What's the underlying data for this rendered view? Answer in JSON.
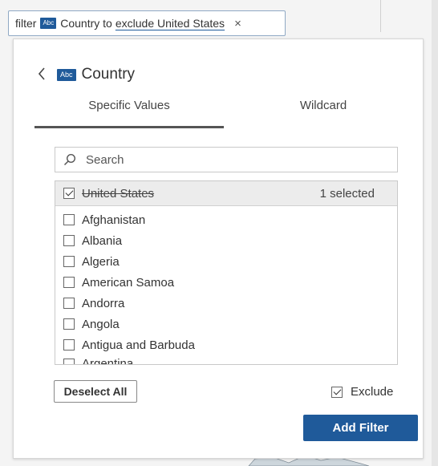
{
  "filter_pill": {
    "prefix": "filter",
    "type_badge": "Abc",
    "field": "Country",
    "connector": "to",
    "value": "exclude United States",
    "close_glyph": "×"
  },
  "panel": {
    "back_glyph": "<",
    "type_badge": "Abc",
    "title": "Country",
    "tabs": {
      "specific": "Specific Values",
      "wildcard": "Wildcard"
    },
    "search": {
      "placeholder": "Search",
      "value": ""
    },
    "selected_item": {
      "label": "United States",
      "checked": true,
      "count_text": "1 selected"
    },
    "items": [
      {
        "label": "Afghanistan",
        "checked": false
      },
      {
        "label": "Albania",
        "checked": false
      },
      {
        "label": "Algeria",
        "checked": false
      },
      {
        "label": "American Samoa",
        "checked": false
      },
      {
        "label": "Andorra",
        "checked": false
      },
      {
        "label": "Angola",
        "checked": false
      },
      {
        "label": "Antigua and Barbuda",
        "checked": false
      },
      {
        "label": "Argentina",
        "checked": false
      }
    ],
    "deselect_all": "Deselect All",
    "exclude": {
      "label": "Exclude",
      "checked": true
    },
    "add_filter": "Add Filter"
  },
  "colors": {
    "accent": "#1f5a9a",
    "tab_underline": "#555555"
  },
  "icons": {
    "search": "search-icon",
    "back": "chevron-left-icon",
    "close": "close-icon"
  }
}
